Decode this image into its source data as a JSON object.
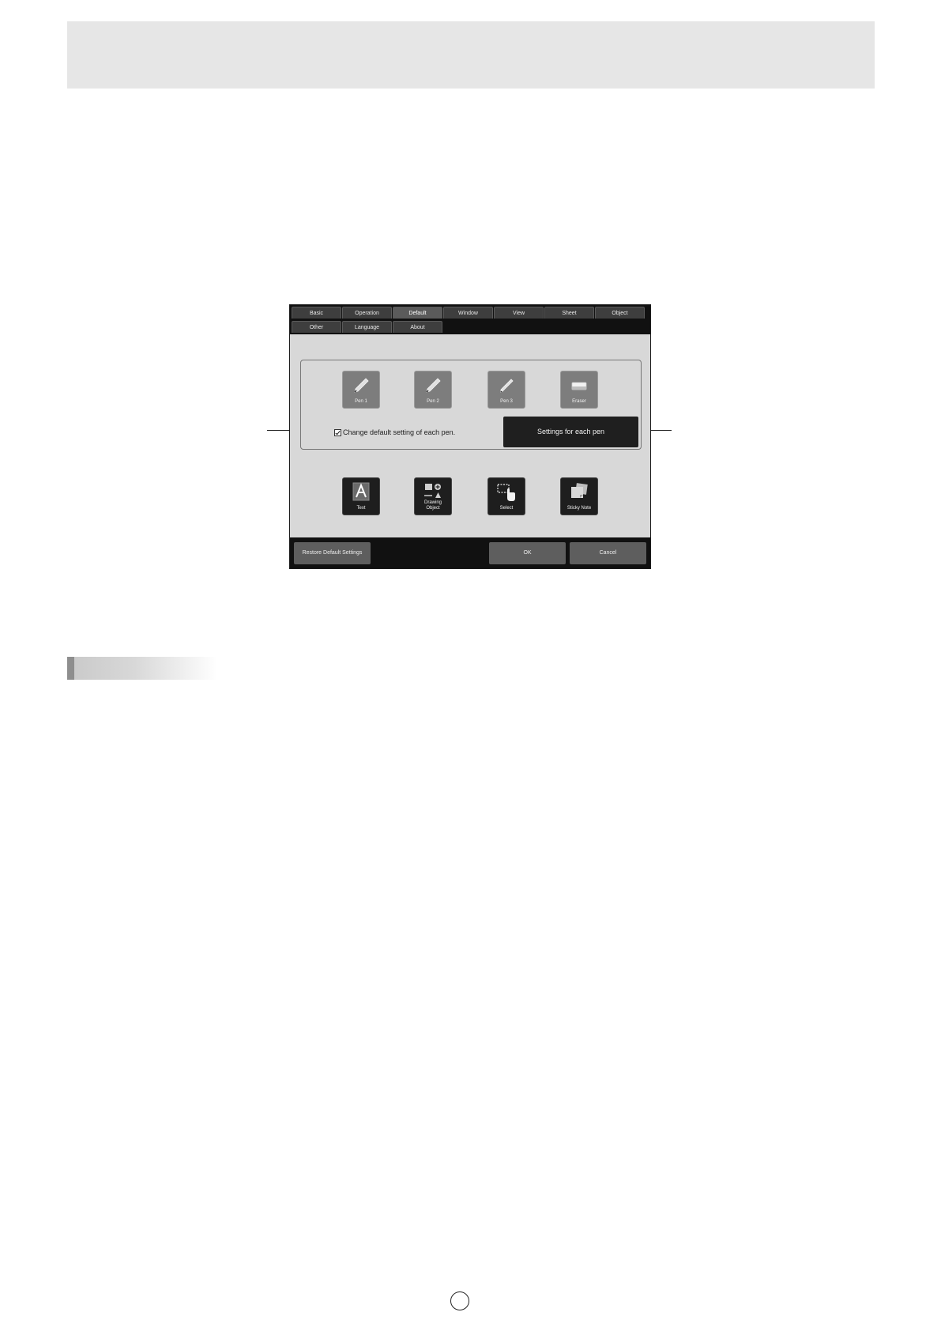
{
  "dialog": {
    "tabs_row1": [
      "Basic",
      "Operation",
      "Default",
      "Window",
      "View",
      "Sheet",
      "Object"
    ],
    "tabs_row2": [
      "Other",
      "Language",
      "About"
    ],
    "active_tab": "Default",
    "pen_tools": [
      {
        "label": "Pen 1",
        "icon": "pen-icon"
      },
      {
        "label": "Pen 2",
        "icon": "pen-icon"
      },
      {
        "label": "Pen 3",
        "icon": "pen-icon"
      },
      {
        "label": "Eraser",
        "icon": "eraser-icon"
      }
    ],
    "checkbox_label": "Change default setting of each pen.",
    "checkbox_checked": true,
    "settings_button": "Settings for each pen",
    "other_tools": [
      {
        "label": "Text",
        "icon": "text-icon"
      },
      {
        "label_line1": "Drawing",
        "label_line2": "Object",
        "icon": "drawing-object-icon"
      },
      {
        "label": "Select",
        "icon": "select-icon"
      },
      {
        "label": "Sticky Note",
        "icon": "sticky-note-icon"
      }
    ],
    "footer": {
      "restore_label": "Restore Default Settings",
      "ok_label": "OK",
      "cancel_label": "Cancel"
    }
  }
}
